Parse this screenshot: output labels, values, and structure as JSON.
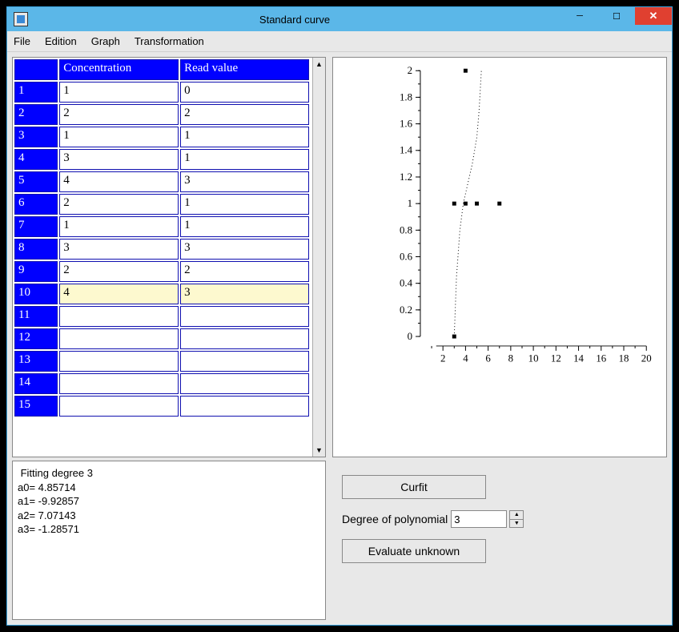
{
  "window": {
    "title": "Standard curve"
  },
  "menu": [
    "File",
    "Edition",
    "Graph",
    "Transformation"
  ],
  "table": {
    "columns": [
      "Concentration",
      "Read value"
    ],
    "highlight_row_index": 9,
    "rows": [
      {
        "n": "1",
        "conc": "1",
        "val": "0"
      },
      {
        "n": "2",
        "conc": "2",
        "val": "2"
      },
      {
        "n": "3",
        "conc": "1",
        "val": "1"
      },
      {
        "n": "4",
        "conc": "3",
        "val": "1"
      },
      {
        "n": "5",
        "conc": "4",
        "val": "3"
      },
      {
        "n": "6",
        "conc": "2",
        "val": "1"
      },
      {
        "n": "7",
        "conc": "1",
        "val": "1"
      },
      {
        "n": "8",
        "conc": "3",
        "val": "3"
      },
      {
        "n": "9",
        "conc": "2",
        "val": "2"
      },
      {
        "n": "10",
        "conc": "4",
        "val": "3"
      },
      {
        "n": "11",
        "conc": "",
        "val": ""
      },
      {
        "n": "12",
        "conc": "",
        "val": ""
      },
      {
        "n": "13",
        "conc": "",
        "val": ""
      },
      {
        "n": "14",
        "conc": "",
        "val": ""
      },
      {
        "n": "15",
        "conc": "",
        "val": ""
      }
    ]
  },
  "fit": {
    "heading": "Fitting degree 3",
    "coeff_lines": [
      "a0= 4.85714",
      "a1= -9.92857",
      "a2= 7.07143",
      "a3= -1.28571"
    ]
  },
  "controls": {
    "curfit_label": "Curfit",
    "degree_label": "Degree of polynomial",
    "degree_value": "3",
    "evaluate_label": "Evaluate unknown"
  },
  "chart_data": {
    "type": "scatter",
    "x_range": [
      0,
      20
    ],
    "y_range": [
      0,
      2
    ],
    "x_ticks": [
      2,
      4,
      6,
      8,
      10,
      12,
      14,
      16,
      18,
      20
    ],
    "y_ticks": [
      0,
      0.2,
      0.4,
      0.6,
      0.8,
      1,
      1.2,
      1.4,
      1.6,
      1.8,
      2
    ],
    "points": [
      {
        "x": 3,
        "y": 0
      },
      {
        "x": 3,
        "y": 1
      },
      {
        "x": 4,
        "y": 1
      },
      {
        "x": 5,
        "y": 1
      },
      {
        "x": 7,
        "y": 1
      },
      {
        "x": 4,
        "y": 2
      }
    ],
    "curve": [
      {
        "x": 3.0,
        "y": 0.0
      },
      {
        "x": 3.2,
        "y": 0.45
      },
      {
        "x": 3.5,
        "y": 0.8
      },
      {
        "x": 3.8,
        "y": 1.0
      },
      {
        "x": 4.2,
        "y": 1.15
      },
      {
        "x": 4.6,
        "y": 1.3
      },
      {
        "x": 5.0,
        "y": 1.5
      },
      {
        "x": 5.2,
        "y": 1.7
      },
      {
        "x": 5.3,
        "y": 1.85
      },
      {
        "x": 5.4,
        "y": 2.0
      }
    ]
  }
}
